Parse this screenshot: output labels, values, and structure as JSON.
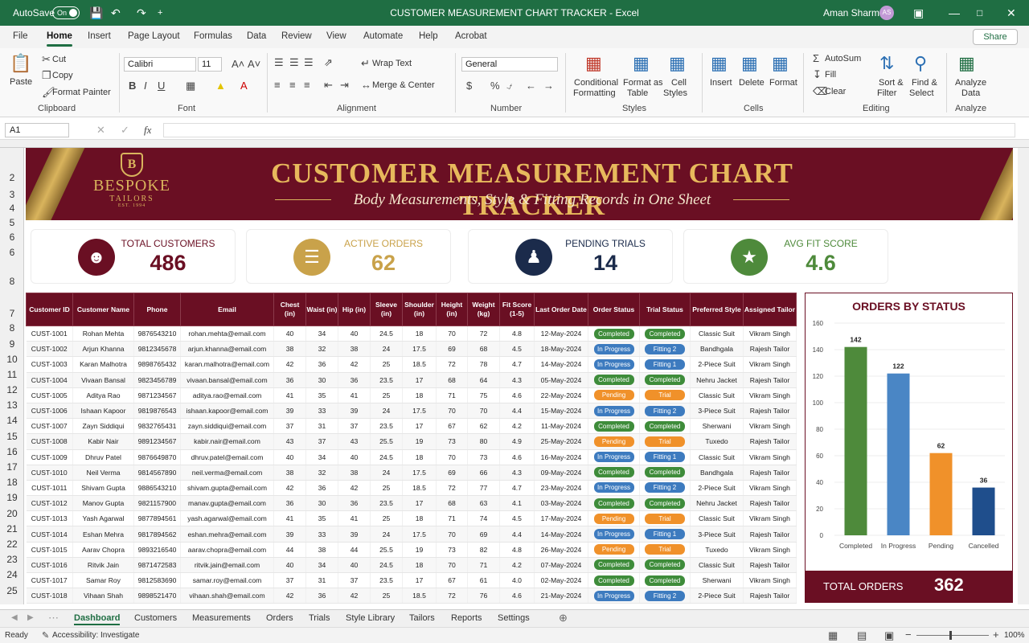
{
  "titlebar": {
    "autosave": "AutoSave",
    "toggle": "On",
    "title": "CUSTOMER MEASUREMENT CHART TRACKER - Excel",
    "user": "Aman Sharma",
    "initials": "AS"
  },
  "menu": {
    "tabs": [
      "File",
      "Home",
      "Insert",
      "Page Layout",
      "Formulas",
      "Data",
      "Review",
      "View",
      "Automate",
      "Help",
      "Acrobat"
    ],
    "share": "Share"
  },
  "ribbon": {
    "paste": "Paste",
    "cut": "Cut",
    "copy": "Copy",
    "format_painter": "Format Painter",
    "clipboard": "Clipboard",
    "font_name": "Calibri",
    "font_size": "11",
    "font": "Font",
    "wrap_text": "Wrap Text",
    "merge_center": "Merge & Center",
    "alignment": "Alignment",
    "number_format": "General",
    "number": "Number",
    "conditional1": "Conditional",
    "conditional2": "Formatting",
    "format_table1": "Format as",
    "format_table2": "Table",
    "cell_styles1": "Cell",
    "cell_styles2": "Styles",
    "styles": "Styles",
    "insert": "Insert",
    "delete": "Delete",
    "format": "Format",
    "cells": "Cells",
    "autosum": "AutoSum",
    "fill": "Fill",
    "clear": "Clear",
    "sort1": "Sort &",
    "sort2": "Filter",
    "find1": "Find &",
    "find2": "Select",
    "editing": "Editing",
    "analyze1": "Analyze",
    "analyze2": "Data",
    "analyze": "Analyze"
  },
  "formula": {
    "namebox": "A1",
    "fx": "fx"
  },
  "row_numbers": [
    "2",
    "3",
    "4",
    "5",
    "6",
    "6",
    "8",
    "7",
    "8",
    "9",
    "10",
    "11",
    "12",
    "13",
    "14",
    "15",
    "16",
    "17",
    "18",
    "19",
    "20",
    "21",
    "22",
    "23",
    "24",
    "25"
  ],
  "banner": {
    "logo1": "BESPOKE",
    "logo2": "TAILORS",
    "logo3": "EST. 1994",
    "title": "CUSTOMER MEASUREMENT CHART TRACKER",
    "subtitle": "Body Measurements, Style & Fitting Records in One Sheet"
  },
  "kpis": [
    {
      "label": "TOTAL CUSTOMERS",
      "value": "486",
      "color": "#6a0f23",
      "icon": "users-icon"
    },
    {
      "label": "ACTIVE ORDERS",
      "value": "62",
      "color": "#c9a24a",
      "icon": "clipboard-icon"
    },
    {
      "label": "PENDING TRIALS",
      "value": "14",
      "color": "#1b2b4b",
      "icon": "mannequin-icon"
    },
    {
      "label": "AVG FIT SCORE",
      "value": "4.6",
      "color": "#4e8a3b",
      "icon": "star-icon"
    }
  ],
  "table": {
    "headers": [
      "Customer ID",
      "Customer Name",
      "Phone",
      "Email",
      "Chest (in)",
      "Waist (in)",
      "Hip (in)",
      "Sleeve (in)",
      "Shoulder (in)",
      "Height (in)",
      "Weight (kg)",
      "Fit Score (1-5)",
      "Last Order Date",
      "Order Status",
      "Trial Status",
      "Preferred Style",
      "Assigned Tailor"
    ],
    "rows": [
      [
        "CUST-1001",
        "Rohan Mehta",
        "9876543210",
        "rohan.mehta@email.com",
        "40",
        "34",
        "40",
        "24.5",
        "18",
        "70",
        "72",
        "4.8",
        "12-May-2024",
        "Completed",
        "Completed",
        "Classic Suit",
        "Vikram Singh"
      ],
      [
        "CUST-1002",
        "Arjun Khanna",
        "9812345678",
        "arjun.khanna@email.com",
        "38",
        "32",
        "38",
        "24",
        "17.5",
        "69",
        "68",
        "4.5",
        "18-May-2024",
        "In Progress",
        "Fitting 2",
        "Bandhgala",
        "Rajesh Tailor"
      ],
      [
        "CUST-1003",
        "Karan Malhotra",
        "9898765432",
        "karan.malhotra@email.com",
        "42",
        "36",
        "42",
        "25",
        "18.5",
        "72",
        "78",
        "4.7",
        "14-May-2024",
        "In Progress",
        "Fitting 1",
        "2-Piece Suit",
        "Vikram Singh"
      ],
      [
        "CUST-1004",
        "Vivaan Bansal",
        "9823456789",
        "vivaan.bansal@email.com",
        "36",
        "30",
        "36",
        "23.5",
        "17",
        "68",
        "64",
        "4.3",
        "05-May-2024",
        "Completed",
        "Completed",
        "Nehru Jacket",
        "Rajesh Tailor"
      ],
      [
        "CUST-1005",
        "Aditya Rao",
        "9871234567",
        "aditya.rao@email.com",
        "41",
        "35",
        "41",
        "25",
        "18",
        "71",
        "75",
        "4.6",
        "22-May-2024",
        "Pending",
        "Trial",
        "Classic Suit",
        "Vikram Singh"
      ],
      [
        "CUST-1006",
        "Ishaan Kapoor",
        "9819876543",
        "ishaan.kapoor@email.com",
        "39",
        "33",
        "39",
        "24",
        "17.5",
        "70",
        "70",
        "4.4",
        "15-May-2024",
        "In Progress",
        "Fitting 2",
        "3-Piece Suit",
        "Rajesh Tailor"
      ],
      [
        "CUST-1007",
        "Zayn Siddiqui",
        "9832765431",
        "zayn.siddiqui@email.com",
        "37",
        "31",
        "37",
        "23.5",
        "17",
        "67",
        "62",
        "4.2",
        "11-May-2024",
        "Completed",
        "Completed",
        "Sherwani",
        "Vikram Singh"
      ],
      [
        "CUST-1008",
        "Kabir Nair",
        "9891234567",
        "kabir.nair@email.com",
        "43",
        "37",
        "43",
        "25.5",
        "19",
        "73",
        "80",
        "4.9",
        "25-May-2024",
        "Pending",
        "Trial",
        "Tuxedo",
        "Rajesh Tailor"
      ],
      [
        "CUST-1009",
        "Dhruv Patel",
        "9876649870",
        "dhruv.patel@email.com",
        "40",
        "34",
        "40",
        "24.5",
        "18",
        "70",
        "73",
        "4.6",
        "16-May-2024",
        "In Progress",
        "Fitting 1",
        "Classic Suit",
        "Vikram Singh"
      ],
      [
        "CUST-1010",
        "Neil Verma",
        "9814567890",
        "neil.verma@email.com",
        "38",
        "32",
        "38",
        "24",
        "17.5",
        "69",
        "66",
        "4.3",
        "09-May-2024",
        "Completed",
        "Completed",
        "Bandhgala",
        "Rajesh Tailor"
      ],
      [
        "CUST-1011",
        "Shivam Gupta",
        "9886543210",
        "shivam.gupta@email.com",
        "42",
        "36",
        "42",
        "25",
        "18.5",
        "72",
        "77",
        "4.7",
        "23-May-2024",
        "In Progress",
        "Fitting 2",
        "2-Piece Suit",
        "Vikram Singh"
      ],
      [
        "CUST-1012",
        "Manov Gupta",
        "9821157900",
        "manav.gupta@email.com",
        "36",
        "30",
        "36",
        "23.5",
        "17",
        "68",
        "63",
        "4.1",
        "03-May-2024",
        "Completed",
        "Completed",
        "Nehru Jacket",
        "Rajesh Tailor"
      ],
      [
        "CUST-1013",
        "Yash Agarwal",
        "9877894561",
        "yash.agarwal@email.com",
        "41",
        "35",
        "41",
        "25",
        "18",
        "71",
        "74",
        "4.5",
        "17-May-2024",
        "Pending",
        "Trial",
        "Classic Suit",
        "Vikram Singh"
      ],
      [
        "CUST-1014",
        "Eshan Mehra",
        "9817894562",
        "eshan.mehra@email.com",
        "39",
        "33",
        "39",
        "24",
        "17.5",
        "70",
        "69",
        "4.4",
        "14-May-2024",
        "In Progress",
        "Fitting 1",
        "3-Piece Suit",
        "Rajesh Tailor"
      ],
      [
        "CUST-1015",
        "Aarav Chopra",
        "9893216540",
        "aarav.chopra@email.com",
        "44",
        "38",
        "44",
        "25.5",
        "19",
        "73",
        "82",
        "4.8",
        "26-May-2024",
        "Pending",
        "Trial",
        "Tuxedo",
        "Vikram Singh"
      ],
      [
        "CUST-1016",
        "Ritvik Jain",
        "9871472583",
        "ritvik.jain@email.com",
        "40",
        "34",
        "40",
        "24.5",
        "18",
        "70",
        "71",
        "4.2",
        "07-May-2024",
        "Completed",
        "Completed",
        "Classic Suit",
        "Rajesh Tailor"
      ],
      [
        "CUST-1017",
        "Samar Roy",
        "9812583690",
        "samar.roy@email.com",
        "37",
        "31",
        "37",
        "23.5",
        "17",
        "67",
        "61",
        "4.0",
        "02-May-2024",
        "Completed",
        "Completed",
        "Sherwani",
        "Vikram Singh"
      ],
      [
        "CUST-1018",
        "Vihaan Shah",
        "9898521470",
        "vihaan.shah@email.com",
        "42",
        "36",
        "42",
        "25",
        "18.5",
        "72",
        "76",
        "4.6",
        "21-May-2024",
        "In Progress",
        "Fitting 2",
        "2-Piece Suit",
        "Rajesh Tailor"
      ]
    ]
  },
  "chart_data": {
    "type": "bar",
    "title": "ORDERS BY STATUS",
    "categories": [
      "Completed",
      "In Progress",
      "Pending",
      "Cancelled"
    ],
    "values": [
      142,
      122,
      62,
      36
    ],
    "colors": [
      "#4e8a3b",
      "#4a86c5",
      "#f0912a",
      "#1f4e8c"
    ],
    "ylim": [
      0,
      160
    ],
    "yticks": [
      0,
      20,
      40,
      60,
      80,
      100,
      120,
      140,
      160
    ]
  },
  "chart_total": {
    "label": "TOTAL ORDERS",
    "value": "362"
  },
  "sheets": [
    "Dashboard",
    "Customers",
    "Measurements",
    "Orders",
    "Trials",
    "Style Library",
    "Tailors",
    "Reports",
    "Settings"
  ],
  "status": {
    "ready": "Ready",
    "accessibility": "Accessibility: Investigate",
    "zoom": "100%"
  }
}
